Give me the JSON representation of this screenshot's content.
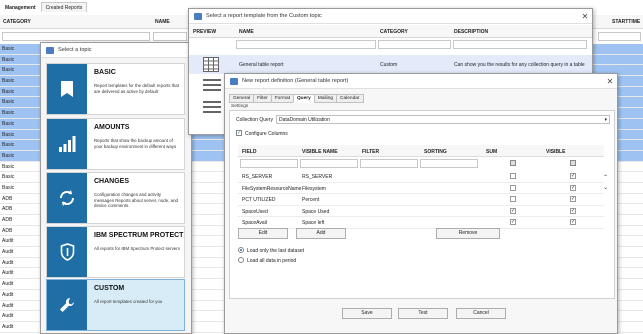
{
  "base": {
    "tabs": [
      "Management",
      "Created Reports"
    ],
    "columns": [
      "CATEGORY",
      "NAME",
      "STARTTIME"
    ],
    "rows": [
      {
        "category": "Basic",
        "selected": true
      },
      {
        "category": "Basic",
        "selected": true
      },
      {
        "category": "Basic",
        "selected": true
      },
      {
        "category": "Basic",
        "selected": true
      },
      {
        "category": "Basic",
        "selected": true
      },
      {
        "category": "Basic",
        "selected": true
      },
      {
        "category": "Basic",
        "selected": true
      },
      {
        "category": "Basic",
        "selected": true
      },
      {
        "category": "Basic",
        "selected": true
      },
      {
        "category": "Basic",
        "selected": true
      },
      {
        "category": "Basic",
        "selected": true
      },
      {
        "category": "Basic",
        "selected": false
      },
      {
        "category": "Basic",
        "selected": false
      },
      {
        "category": "Basic",
        "selected": false
      },
      {
        "category": "ADB",
        "selected": false
      },
      {
        "category": "ADB",
        "selected": false
      },
      {
        "category": "ADB",
        "selected": false
      },
      {
        "category": "ADB",
        "selected": false
      },
      {
        "category": "Audit",
        "selected": false
      },
      {
        "category": "Audit",
        "selected": false
      },
      {
        "category": "Audit",
        "selected": false
      },
      {
        "category": "Audit",
        "selected": false
      },
      {
        "category": "Audit",
        "selected": false
      },
      {
        "category": "Audit",
        "selected": false
      },
      {
        "category": "Audit",
        "selected": false
      },
      {
        "category": "Audit",
        "selected": false
      },
      {
        "category": "Audit",
        "selected": false
      }
    ]
  },
  "topic_window": {
    "title": "Select a topic",
    "cards": [
      {
        "title": "BASIC",
        "desc": "Report templates for the default reports that are delivered as active by default",
        "icon": "bookmark-icon",
        "selected": false
      },
      {
        "title": "AMOUNTS",
        "desc": "Reports that show the backup amount of your backup environment in different ways",
        "icon": "signal-bars-icon",
        "selected": false
      },
      {
        "title": "CHANGES",
        "desc": "Configuration changes and activity messages Reports about server, node, and device comments.",
        "icon": "sync-arrows-icon",
        "selected": false
      },
      {
        "title": "IBM SPECTRUM PROTECT",
        "desc": "All reports for IBM Spectrum Protect servers",
        "icon": "shield-icon",
        "selected": false
      },
      {
        "title": "CUSTOM",
        "desc": "All report templates created for you",
        "icon": "wrench-icon",
        "selected": true
      }
    ]
  },
  "template_window": {
    "title": "Select a report template from the Custom topic",
    "columns": [
      "PREVIEW",
      "NAME",
      "CATEGORY",
      "DESCRIPTION"
    ],
    "row": {
      "name": "General table report",
      "category": "Custom",
      "description": "Can show you the results for any collection query in a table"
    }
  },
  "def_window": {
    "title": "New report definition (General table report)",
    "tabs": [
      "General",
      "Filter",
      "Format",
      "Query",
      "Mailing",
      "Calendar"
    ],
    "active_tab": "Query",
    "settings_label": "Settings",
    "collection_query_label": "Collection Query",
    "collection_query_value": "DataDomain Utilization",
    "configure_columns_label": "Configure Columns",
    "grid_columns": [
      "FIELD",
      "VISIBLE NAME",
      "FILTER",
      "SORTING",
      "SUM",
      "VISIBLE"
    ],
    "grid_rows": [
      {
        "field": "RS_SERVER",
        "visible_name": "RS_SERVER",
        "sum": false,
        "visible": true
      },
      {
        "field": "FileSystemResourceName",
        "visible_name": "Filesystem",
        "sum": false,
        "visible": true
      },
      {
        "field": "PCT UTILIZED",
        "visible_name": "Percent",
        "sum": false,
        "visible": true
      },
      {
        "field": "SpaceUsed",
        "visible_name": "Space Used",
        "sum": true,
        "visible": true
      },
      {
        "field": "SpaceAvail",
        "visible_name": "Space left",
        "sum": true,
        "visible": true
      }
    ],
    "buttons": {
      "edit": "Edit",
      "add": "Add",
      "remove": "Remove"
    },
    "radio_last": "Load only the last dataset",
    "radio_all": "Load all data in period",
    "footer": {
      "save": "Save",
      "test": "Test",
      "cancel": "Cancel"
    }
  }
}
